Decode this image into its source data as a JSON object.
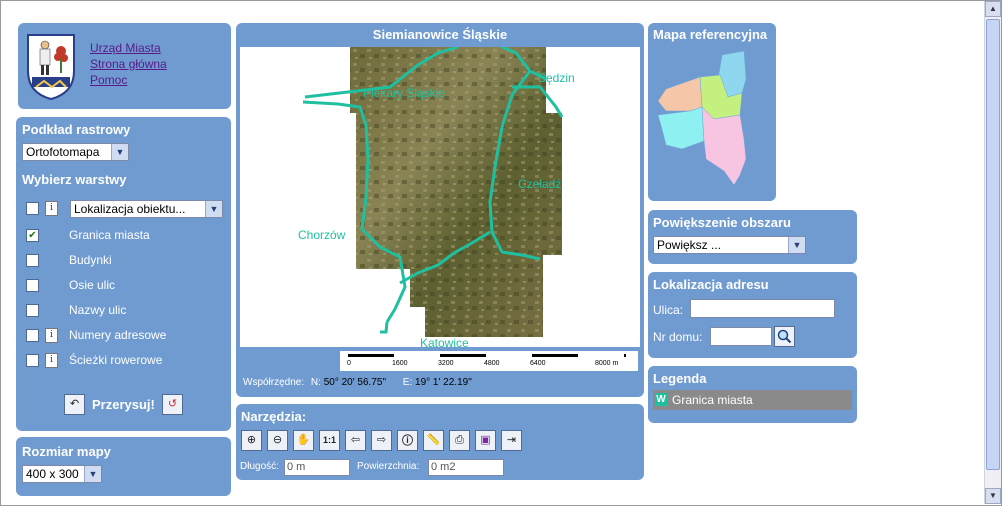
{
  "header": {
    "links": [
      "Urząd Miasta",
      "Strona główna",
      "Pomoc"
    ]
  },
  "raster": {
    "title": "Podkład rastrowy",
    "selected": "Ortofotomapa",
    "layers_title": "Wybierz warstwy",
    "layer_select": "Lokalizacja obiektu...",
    "layers": [
      {
        "label": "Granica miasta",
        "checked": true,
        "info": false
      },
      {
        "label": "Budynki",
        "checked": false,
        "info": false
      },
      {
        "label": "Osie ulic",
        "checked": false,
        "info": false
      },
      {
        "label": "Nazwy ulic",
        "checked": false,
        "info": false
      },
      {
        "label": "Numery adresowe",
        "checked": false,
        "info": true
      },
      {
        "label": "Ścieżki rowerowe",
        "checked": false,
        "info": true
      }
    ],
    "redraw_label": "Przerysuj!"
  },
  "size": {
    "title": "Rozmiar mapy",
    "selected": "400 x 300"
  },
  "map": {
    "title": "Siemianowice Śląskie",
    "places": [
      "Piekary Śląskie",
      "Będzin",
      "Czeladź",
      "Chorzów",
      "Katowice"
    ],
    "scale_ticks": [
      "0",
      "1600",
      "3200",
      "4800",
      "6400",
      "8000 m"
    ],
    "coords_label": "Współrzędne:",
    "n_label": "N:",
    "n_value": "50° 20' 56.75\"",
    "e_label": "E:",
    "e_value": "19° 1' 22.19\""
  },
  "tools": {
    "title": "Narzędzia:",
    "buttons": [
      "zoom-in",
      "zoom-out",
      "pan",
      "1:1",
      "previous",
      "next",
      "info",
      "measure",
      "print",
      "legend",
      "export"
    ],
    "length_label": "Długość:",
    "length_value": "0 m",
    "area_label": "Powierzchnia:",
    "area_value": "0 m2"
  },
  "refmap": {
    "title": "Mapa referencyjna"
  },
  "zoom": {
    "title": "Powiększenie obszaru",
    "selected": "Powiększ ..."
  },
  "address": {
    "title": "Lokalizacja adresu",
    "street_label": "Ulica:",
    "house_label": "Nr domu:",
    "street_value": "",
    "house_value": ""
  },
  "legend": {
    "title": "Legenda",
    "items": [
      "Granica miasta"
    ]
  },
  "colors": {
    "panel": "#6f9bd1",
    "boundary": "#1fc0a0",
    "link": "#5a1a8a"
  }
}
